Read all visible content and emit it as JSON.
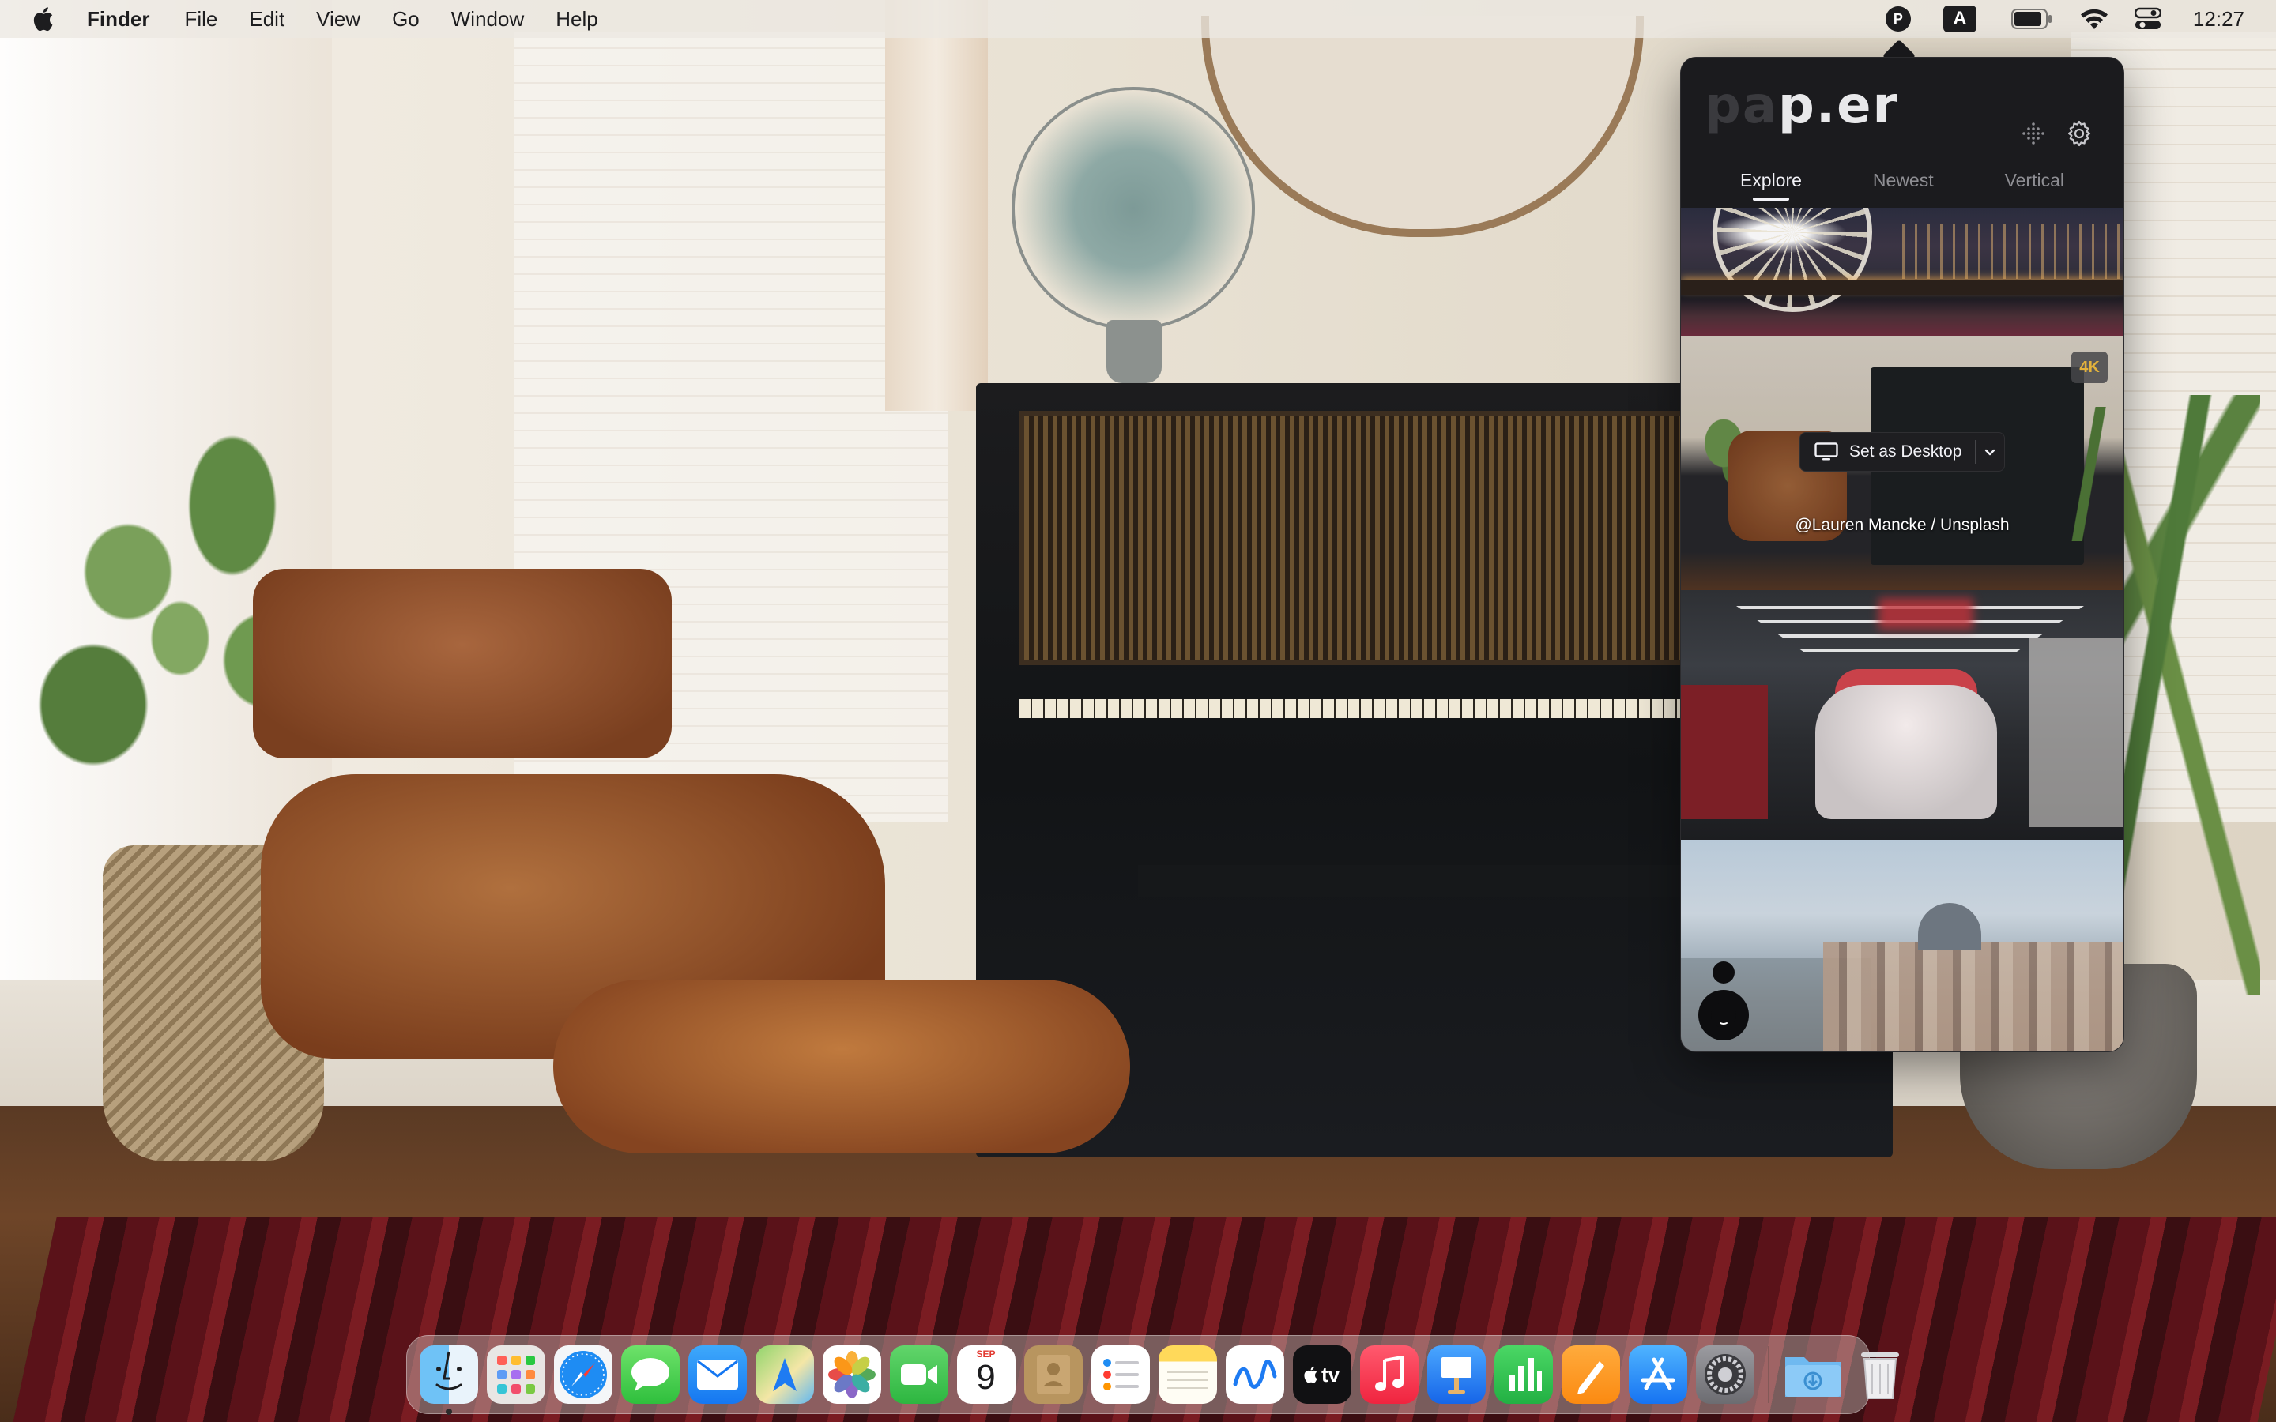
{
  "menubar": {
    "app_name": "Finder",
    "menus": [
      "File",
      "Edit",
      "View",
      "Go",
      "Window",
      "Help"
    ],
    "status_icons": [
      "paper-app-icon",
      "input-source-icon",
      "battery-icon",
      "wifi-icon",
      "control-center-icon"
    ],
    "input_source_label": "A",
    "paper_app_label": "P",
    "clock": "12:27"
  },
  "paper_popover": {
    "logo_dim": "pa",
    "logo_main": "p.er",
    "tabs": [
      "Explore",
      "Newest",
      "Vertical"
    ],
    "active_tab": "Explore",
    "selected_wallpaper": {
      "badge": "4K",
      "action_label": "Set as Desktop",
      "credit": "@Lauren Mancke / Unsplash"
    },
    "thumbnails": [
      "ferris-wheel-pier-night",
      "living-room-piano-chair",
      "mini-cooper-garage",
      "venice-aerial"
    ]
  },
  "dock": {
    "apps": [
      "Finder",
      "Launchpad",
      "Safari",
      "Messages",
      "Mail",
      "Maps",
      "Photos",
      "FaceTime",
      "Calendar",
      "Contacts",
      "Reminders",
      "Notes",
      "Freeform",
      "TV",
      "Music",
      "Keynote",
      "Numbers",
      "Pages",
      "App Store",
      "System Settings",
      "Downloads",
      "Trash"
    ],
    "calendar_month": "SEP",
    "calendar_day": "9",
    "tv_label": "tv"
  },
  "colors": {
    "menubar_bg": "#ece8e2",
    "popover_bg": "#1b1b1e",
    "badge_4k": "#e3b23c",
    "tab_active": "#f2f2f7",
    "tab_inactive": "#8e8e93"
  }
}
